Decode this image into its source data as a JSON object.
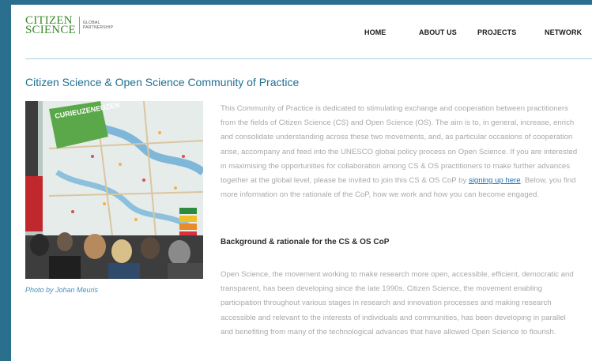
{
  "logo": {
    "line1": "CITIZEN",
    "line2": "SCIENCE",
    "tag1": "GLOBAL",
    "tag2": "PARTNERSHIP"
  },
  "nav": {
    "home": "HOME",
    "about": "ABOUT US",
    "projects": "PROJECTS",
    "network": "NETWORK"
  },
  "page": {
    "title": "Citizen Science & Open Science Community of Practice",
    "caption": "Photo by Johan Meuris",
    "intro_before": "This Community of Practice is dedicated to stimulating exchange and cooperation between practitioners from the fields of Citizen Science (CS) and Open Science (OS). The aim is to, in general, increase, enrich and consolidate understanding across these two movements, and, as particular occasions of cooperation arise, accompany and feed into the UNESCO global policy process on Open Science. If you are interested in maximising the opportunities for collaboration among CS & OS practitioners to make further advances together at the global level, please be invited to join this CS & OS CoP by ",
    "intro_link": "signing up here",
    "intro_after": ". Below, you find more information on the rationale of the CoP, how we work and how you can become engaged.",
    "subheading": "Background & rationale for the CS & OS CoP",
    "para2": "Open Science, the movement working to make research more open, accessible, efficient, democratic and transparent, has been developing since the late 1990s. Citizen Science, the movement enabling participation throughout various stages in research and innovation processes and making research accessible and relevant to the interests of individuals and communities, has been developing in parallel and benefiting from many of the technological advances that have allowed Open Science to flourish."
  },
  "photo": {
    "banner_word": "CURIEUZENEUZEN"
  },
  "colors": {
    "page_bg": "#2b6f8e",
    "title": "#1e6f92",
    "logo_green": "#3a8a2e",
    "link": "#1f6fb0",
    "body_text": "#a9a9a9"
  }
}
